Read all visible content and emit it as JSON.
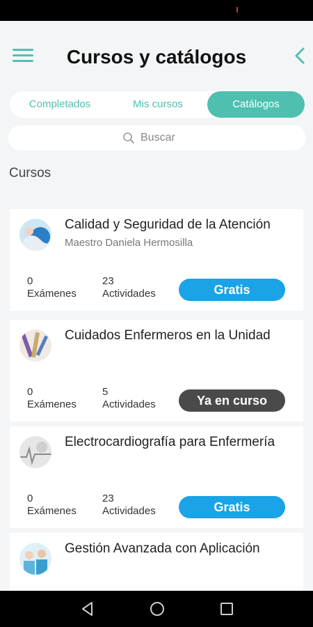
{
  "header": {
    "title": "Cursos y catálogos",
    "menu_icon": "hamburger-menu-icon",
    "back_icon": "chevron-left-icon",
    "accent_color": "#4fc0b0"
  },
  "tabs": [
    {
      "label": "Completados",
      "active": false
    },
    {
      "label": "Mis cursos",
      "active": false
    },
    {
      "label": "Catálogos",
      "active": true
    }
  ],
  "search": {
    "placeholder": "Buscar",
    "icon": "search-icon"
  },
  "section": {
    "title": "Cursos"
  },
  "courses": [
    {
      "title": "Calidad y Seguridad de la Atención",
      "author": "Maestro Daniela Hermosilla",
      "exams_count": "0",
      "exams_label": "Exámenes",
      "activities_count": "23",
      "activities_label": "Actividades",
      "button_label": "Gratis",
      "button_color": "#1aa3e6"
    },
    {
      "title": "Cuidados Enfermeros en la Unidad",
      "author": "",
      "exams_count": "0",
      "exams_label": "Exámenes",
      "activities_count": "5",
      "activities_label": "Actividades",
      "button_label": "Ya en curso",
      "button_color": "#4a4a4a"
    },
    {
      "title": "Electrocardiografía para Enfermería",
      "author": "",
      "exams_count": "0",
      "exams_label": "Exámenes",
      "activities_count": "23",
      "activities_label": "Actividades",
      "button_label": "Gratis",
      "button_color": "#1aa3e6"
    },
    {
      "title": "Gestión Avanzada con Aplicación",
      "author": ""
    }
  ],
  "system_nav": {
    "back_icon": "triangle-back-icon",
    "home_icon": "circle-home-icon",
    "recents_icon": "square-recents-icon"
  }
}
